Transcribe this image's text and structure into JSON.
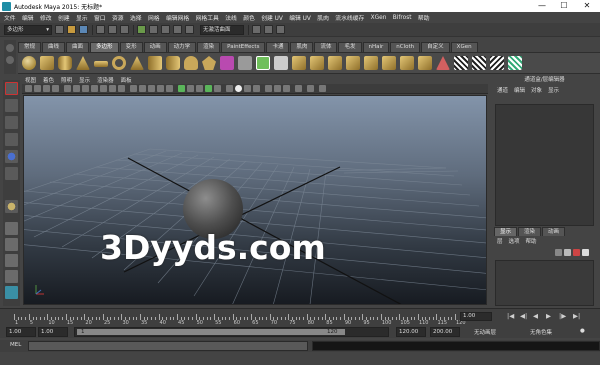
{
  "window": {
    "title": "Autodesk Maya 2015: 无标题*",
    "controls": [
      "—",
      "☐",
      "✕"
    ]
  },
  "menu": [
    "文件",
    "编辑",
    "修改",
    "创建",
    "显示",
    "窗口",
    "资源",
    "选择",
    "网格",
    "编辑网格",
    "网格工具",
    "法线",
    "颜色",
    "创建 UV",
    "编辑 UV",
    "肌肉",
    "流水线缓存",
    "XGen",
    "Bifrost",
    "帮助"
  ],
  "status_line": {
    "mode": "多边形",
    "live_surface": "无激活曲面"
  },
  "shelf_tabs": [
    "常规",
    "曲线",
    "曲面",
    "多边形",
    "变形",
    "动画",
    "动力学",
    "渲染",
    "PaintEffects",
    "卡通",
    "肌肉",
    "流体",
    "毛发",
    "nHair",
    "nCloth",
    "自定义",
    "XGen"
  ],
  "shelf_active_tab": "多边形",
  "panel_menu": [
    "视图",
    "着色",
    "照明",
    "显示",
    "渲染器",
    "面板"
  ],
  "right_panel": {
    "title": "通道盒/层编辑器",
    "menu": [
      "通道",
      "编辑",
      "对象",
      "显示"
    ],
    "layer_tabs": [
      "显示",
      "渲染",
      "动画"
    ],
    "layer_menu": [
      "层",
      "选项",
      "帮助"
    ]
  },
  "timeline": {
    "ticks": [
      "1",
      "5",
      "10",
      "15",
      "20",
      "25",
      "30",
      "35",
      "40",
      "45",
      "50",
      "55",
      "60",
      "65",
      "70",
      "75",
      "80",
      "85",
      "90",
      "95",
      "100",
      "105",
      "110",
      "115",
      "120"
    ],
    "current_frame": "1.00",
    "playback": [
      "|◀",
      "◀|",
      "◀",
      "▶",
      "|▶",
      "▶|"
    ]
  },
  "range": {
    "start": "1.00",
    "start2": "1.00",
    "slider_start": "1",
    "slider_end": "120",
    "end": "120.00",
    "end2": "200.00",
    "anim_layer": "无动画层",
    "char_set": "无角色集"
  },
  "mel_label": "MEL",
  "watermark": "3Dyyds.com",
  "colors": {
    "accent_blue": "#5b87b5",
    "viewport_top": "#8394aa",
    "viewport_bottom": "#171b21"
  }
}
